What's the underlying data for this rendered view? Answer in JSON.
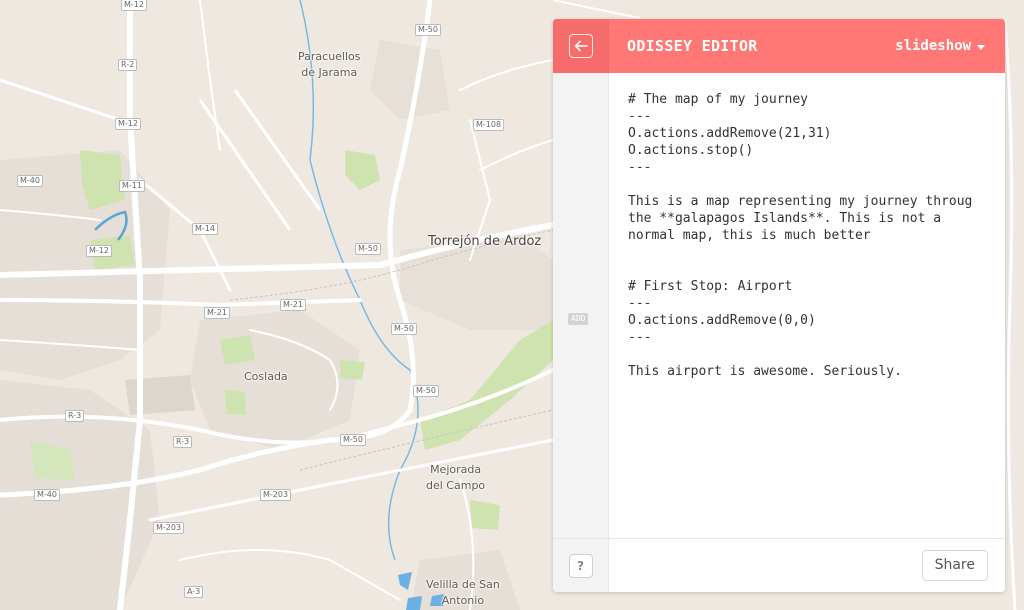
{
  "map": {
    "places": [
      {
        "id": "paracuellos",
        "lines": [
          "Paracuellos",
          "de Jarama"
        ],
        "size": "small"
      },
      {
        "id": "torrejon",
        "lines": [
          "Torrejón de Ardoz"
        ],
        "size": "big"
      },
      {
        "id": "coslada",
        "lines": [
          "Coslada"
        ],
        "size": "small"
      },
      {
        "id": "mejorada",
        "lines": [
          "Mejorada",
          "del Campo"
        ],
        "size": "small"
      },
      {
        "id": "velilla",
        "lines": [
          "Velilla de San",
          "Antonio"
        ],
        "size": "small"
      }
    ],
    "road_shields": [
      "M-12",
      "M-50",
      "R-2",
      "M-12",
      "M-108",
      "M-40",
      "M-11",
      "M-14",
      "M-12",
      "M-50",
      "M-21",
      "M-21",
      "M-50",
      "M-50",
      "R-3",
      "R-3",
      "M-50",
      "M-40",
      "M-203",
      "M-203",
      "A-3"
    ]
  },
  "editor": {
    "title": "ODISSEY EDITOR",
    "mode": "slideshow",
    "add_label": "ADD",
    "code_lines": [
      "# The map of my journey",
      "---",
      "O.actions.addRemove(21,31)",
      "O.actions.stop()",
      "---",
      "",
      "This is a map representing my journey throug",
      "the **galapagos Islands**. This is not a",
      "normal map, this is much better",
      "",
      "",
      "# First Stop: Airport",
      "---",
      "O.actions.addRemove(0,0)",
      "---",
      "",
      "This airport is awesome. Seriously."
    ],
    "help_label": "?",
    "share_label": "Share",
    "colors": {
      "header": "#ff7876",
      "header_dark": "#f56c6a",
      "gutter": "#f3f3f3"
    }
  },
  "icons": {
    "back": "arrow-left-icon",
    "dropdown": "caret-down-icon"
  }
}
